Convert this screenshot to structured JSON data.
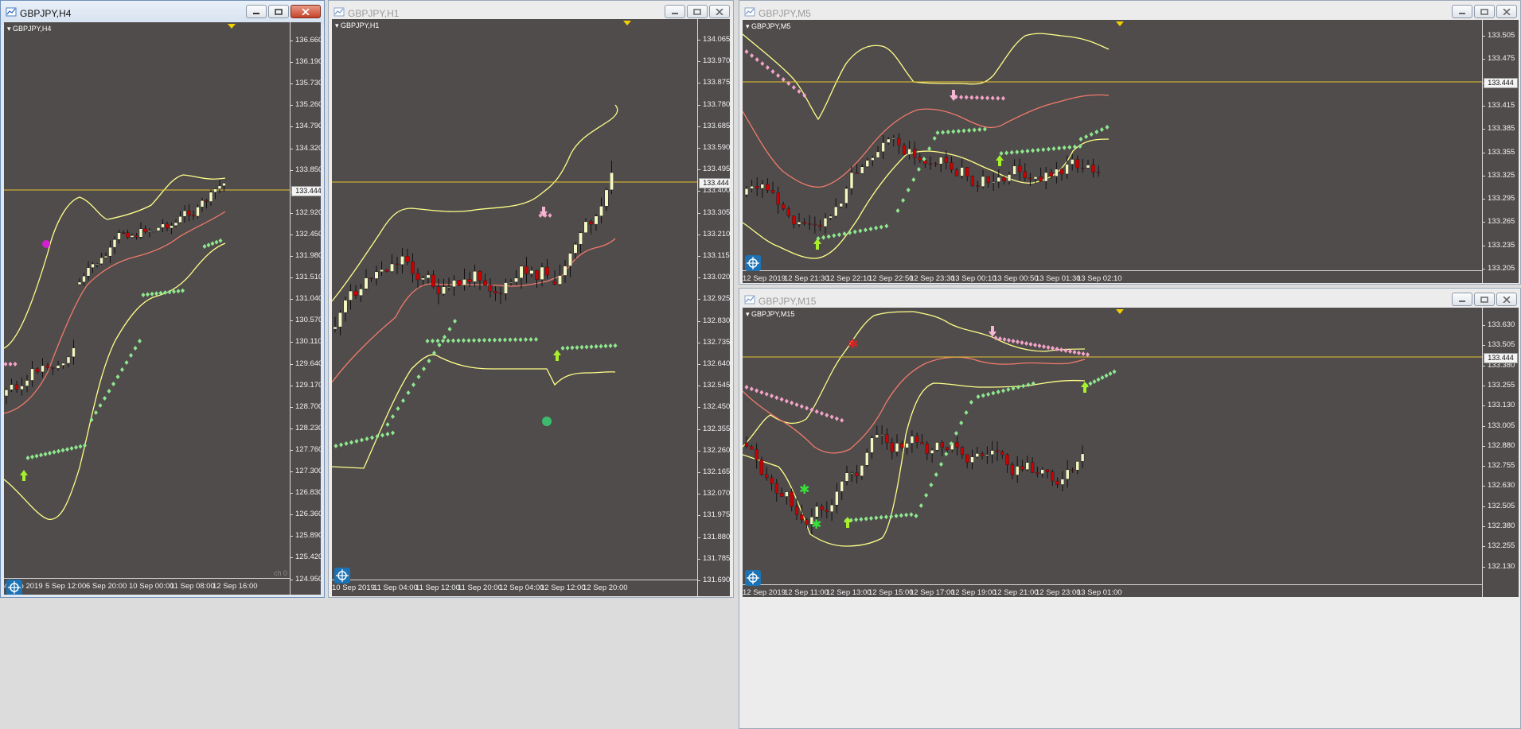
{
  "colors": {
    "background": "#504c4c",
    "bull": "#f3f8c3",
    "bear": "#cc0000",
    "band": "#ffff88",
    "middle": "#f07a6a",
    "psar_up": "#8ee88e",
    "psar_down": "#f4a3c8",
    "price_line": "#e6c42e",
    "arrow_up": "#a7f02a",
    "arrow_down": "#f4b6d2"
  },
  "windows": [
    {
      "title": "GBPJPY,H4",
      "symbol_label": "GBPJPY,H4",
      "current_price": "133.444",
      "extra_label": "ch 0",
      "price_scale": [
        "136.660",
        "136.190",
        "135.730",
        "135.260",
        "134.790",
        "134.320",
        "133.850",
        "133.390",
        "132.920",
        "132.450",
        "131.980",
        "131.510",
        "131.040",
        "130.570",
        "130.110",
        "129.640",
        "129.170",
        "128.700",
        "128.230",
        "127.760",
        "127.300",
        "126.830",
        "126.360",
        "125.890",
        "125.420",
        "124.950"
      ],
      "time_scale": [
        "4 Sep 2019",
        "5 Sep 12:00",
        "6 Sep 20:00",
        "10 Sep 00:00",
        "11 Sep 08:00",
        "12 Sep 16:00"
      ]
    },
    {
      "title": "GBPJPY,H1",
      "symbol_label": "GBPJPY,H1",
      "current_price": "133.444",
      "price_scale": [
        "134.065",
        "133.970",
        "133.875",
        "133.780",
        "133.685",
        "133.590",
        "133.495",
        "133.400",
        "133.305",
        "133.210",
        "133.115",
        "133.020",
        "132.925",
        "132.830",
        "132.735",
        "132.640",
        "132.545",
        "132.450",
        "132.355",
        "132.260",
        "132.165",
        "132.070",
        "131.975",
        "131.880",
        "131.785",
        "131.690"
      ],
      "time_scale": [
        "10 Sep 2019",
        "11 Sep 04:00",
        "11 Sep 12:00",
        "11 Sep 20:00",
        "12 Sep 04:00",
        "12 Sep 12:00",
        "12 Sep 20:00"
      ]
    },
    {
      "title": "GBPJPY,M5",
      "symbol_label": "GBPJPY,M5",
      "current_price": "133.444",
      "price_scale": [
        "133.505",
        "133.475",
        "133.445",
        "133.415",
        "133.385",
        "133.355",
        "133.325",
        "133.295",
        "133.265",
        "133.235",
        "133.205"
      ],
      "time_scale": [
        "12 Sep 2019",
        "12 Sep 21:30",
        "12 Sep 22:10",
        "12 Sep 22:50",
        "12 Sep 23:30",
        "13 Sep 00:10",
        "13 Sep 00:50",
        "13 Sep 01:30",
        "13 Sep 02:10"
      ]
    },
    {
      "title": "GBPJPY,M15",
      "symbol_label": "GBPJPY,M15",
      "current_price": "133.444",
      "price_scale": [
        "133.630",
        "133.505",
        "133.380",
        "133.255",
        "133.130",
        "133.005",
        "132.880",
        "132.755",
        "132.630",
        "132.505",
        "132.380",
        "132.255",
        "132.130"
      ],
      "time_scale": [
        "12 Sep 2019",
        "12 Sep 11:00",
        "12 Sep 13:00",
        "12 Sep 15:00",
        "12 Sep 17:00",
        "12 Sep 19:00",
        "12 Sep 21:00",
        "12 Sep 23:00",
        "13 Sep 01:00"
      ]
    }
  ]
}
